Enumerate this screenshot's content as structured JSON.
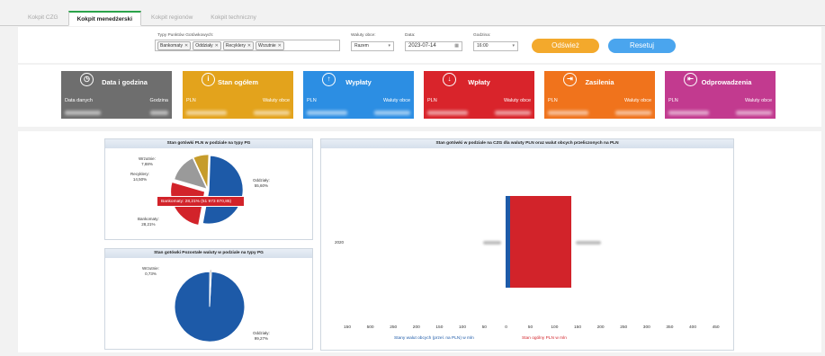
{
  "tabs": [
    {
      "label": "Kokpit CZG",
      "active": false
    },
    {
      "label": "Kokpit menedżerski",
      "active": true
    },
    {
      "label": "Kokpit regionów",
      "active": false
    },
    {
      "label": "Kokpit techniczny",
      "active": false
    }
  ],
  "filters": {
    "pg_types_label": "Typy Punktów Gotówkowych:",
    "pg_types": [
      "Bankomaty",
      "Oddziały",
      "Recyklery",
      "Wrzutnie"
    ],
    "currency_label": "Waluty obce:",
    "currency_value": "Razem",
    "date_label": "Data:",
    "date_value": "2023-07-14",
    "hour_label": "Godzina:",
    "hour_value": "16:00",
    "refresh_label": "Odśwież",
    "reset_label": "Resetuj"
  },
  "colors": {
    "card_date": "#6e6e6e",
    "card_state": "#e3a31c",
    "card_payouts": "#2c8ee3",
    "card_deposits": "#d9242b",
    "card_supply": "#f0731c",
    "card_withdraw": "#c23a8f",
    "pie_blue": "#1d5aa8",
    "pie_red": "#d2232a",
    "pie_gray": "#9a9a9a",
    "pie_gold": "#c69c2b",
    "btn_orange": "#f3a92c",
    "btn_blue": "#4aa5ee"
  },
  "cards": [
    {
      "title": "Data i godzina",
      "icon": "clock-icon",
      "sub_left": "Data danych",
      "sub_right": "Godzina"
    },
    {
      "title": "Stan ogółem",
      "icon": "info-icon",
      "sub_left": "PLN",
      "sub_right": "Waluty obce"
    },
    {
      "title": "Wypłaty",
      "icon": "arrow-up-icon",
      "sub_left": "PLN",
      "sub_right": "Waluty obce"
    },
    {
      "title": "Wpłaty",
      "icon": "arrow-down-icon",
      "sub_left": "PLN",
      "sub_right": "Waluty obce"
    },
    {
      "title": "Zasilenia",
      "icon": "sign-in-icon",
      "sub_left": "PLN",
      "sub_right": "Waluty obce"
    },
    {
      "title": "Odprowadzenia",
      "icon": "sign-out-icon",
      "sub_left": "PLN",
      "sub_right": "Waluty obce"
    }
  ],
  "chart_data": [
    {
      "type": "pie",
      "title": "Stan gotówki PLN w podziale na typy PG",
      "slices": [
        {
          "label": "Oddziały",
          "pct": "55,60%",
          "value": 55.6
        },
        {
          "label": "Bankomaty",
          "pct": "28,21%",
          "value": 28.21
        },
        {
          "label": "Recyklery",
          "pct": "14,50%",
          "value": 14.5
        },
        {
          "label": "Wrzutnie",
          "pct": "7,88%",
          "value": 7.88
        }
      ],
      "tooltip": "Bankomaty: 28,21% (51 973 870,85)"
    },
    {
      "type": "pie",
      "title": "Stan gotówki Pozostałe waluty w podziale na typy PG",
      "slices": [
        {
          "label": "Oddziały",
          "pct": "99,27%",
          "value": 99.27
        },
        {
          "label": "Wrzutnie",
          "pct": "0,73%",
          "value": 0.73
        }
      ]
    },
    {
      "type": "bar",
      "title": "Stan gotówki w podziale na CZG dla waluty PLN oraz walut obcych przeliczonych na PLN",
      "category": "2020",
      "ticks": [
        "150",
        "500",
        "250",
        "200",
        "150",
        "100",
        "50",
        "0",
        "50",
        "100",
        "150",
        "200",
        "250",
        "300",
        "350",
        "400",
        "450"
      ],
      "legend_blue": "Stany walut obcych (przel. na PLN) w mln",
      "legend_red": "Stan ogólny PLN w mln"
    }
  ]
}
